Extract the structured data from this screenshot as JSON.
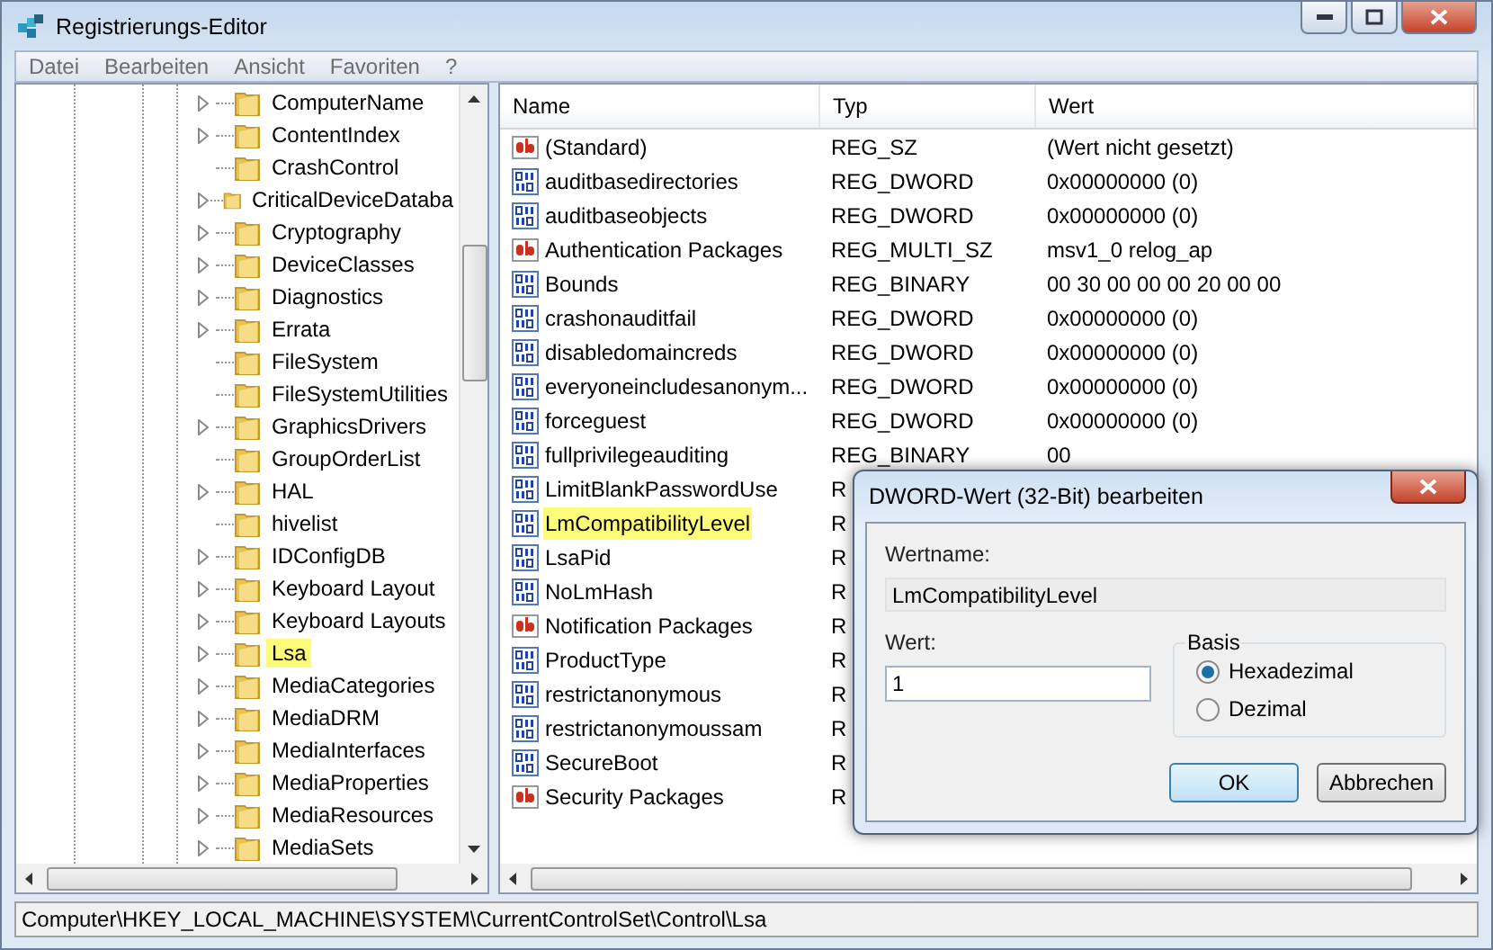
{
  "window": {
    "title": "Registrierungs-Editor"
  },
  "menu": [
    "Datei",
    "Bearbeiten",
    "Ansicht",
    "Favoriten",
    "?"
  ],
  "tree": {
    "items": [
      {
        "label": "ComputerName",
        "expandable": true,
        "selected": false
      },
      {
        "label": "ContentIndex",
        "expandable": true,
        "selected": false
      },
      {
        "label": "CrashControl",
        "expandable": false,
        "selected": false
      },
      {
        "label": "CriticalDeviceDataba",
        "expandable": true,
        "selected": false
      },
      {
        "label": "Cryptography",
        "expandable": true,
        "selected": false
      },
      {
        "label": "DeviceClasses",
        "expandable": true,
        "selected": false
      },
      {
        "label": "Diagnostics",
        "expandable": true,
        "selected": false
      },
      {
        "label": "Errata",
        "expandable": true,
        "selected": false
      },
      {
        "label": "FileSystem",
        "expandable": false,
        "selected": false
      },
      {
        "label": "FileSystemUtilities",
        "expandable": false,
        "selected": false
      },
      {
        "label": "GraphicsDrivers",
        "expandable": true,
        "selected": false
      },
      {
        "label": "GroupOrderList",
        "expandable": false,
        "selected": false
      },
      {
        "label": "HAL",
        "expandable": true,
        "selected": false
      },
      {
        "label": "hivelist",
        "expandable": false,
        "selected": false
      },
      {
        "label": "IDConfigDB",
        "expandable": true,
        "selected": false
      },
      {
        "label": "Keyboard Layout",
        "expandable": true,
        "selected": false
      },
      {
        "label": "Keyboard Layouts",
        "expandable": true,
        "selected": false
      },
      {
        "label": "Lsa",
        "expandable": true,
        "selected": true
      },
      {
        "label": "MediaCategories",
        "expandable": true,
        "selected": false
      },
      {
        "label": "MediaDRM",
        "expandable": true,
        "selected": false
      },
      {
        "label": "MediaInterfaces",
        "expandable": true,
        "selected": false
      },
      {
        "label": "MediaProperties",
        "expandable": true,
        "selected": false
      },
      {
        "label": "MediaResources",
        "expandable": true,
        "selected": false
      },
      {
        "label": "MediaSets",
        "expandable": true,
        "selected": false
      }
    ]
  },
  "table": {
    "columns": [
      "Name",
      "Typ",
      "Wert"
    ],
    "rows": [
      {
        "kind": "string",
        "name": "(Standard)",
        "type": "REG_SZ",
        "value": "(Wert nicht gesetzt)",
        "selected": false
      },
      {
        "kind": "binary",
        "name": "auditbasedirectories",
        "type": "REG_DWORD",
        "value": "0x00000000 (0)",
        "selected": false
      },
      {
        "kind": "binary",
        "name": "auditbaseobjects",
        "type": "REG_DWORD",
        "value": "0x00000000 (0)",
        "selected": false
      },
      {
        "kind": "string",
        "name": "Authentication Packages",
        "type": "REG_MULTI_SZ",
        "value": "msv1_0 relog_ap",
        "selected": false
      },
      {
        "kind": "binary",
        "name": "Bounds",
        "type": "REG_BINARY",
        "value": "00 30 00 00 00 20 00 00",
        "selected": false
      },
      {
        "kind": "binary",
        "name": "crashonauditfail",
        "type": "REG_DWORD",
        "value": "0x00000000 (0)",
        "selected": false
      },
      {
        "kind": "binary",
        "name": "disabledomaincreds",
        "type": "REG_DWORD",
        "value": "0x00000000 (0)",
        "selected": false
      },
      {
        "kind": "binary",
        "name": "everyoneincludesanonym...",
        "type": "REG_DWORD",
        "value": "0x00000000 (0)",
        "selected": false
      },
      {
        "kind": "binary",
        "name": "forceguest",
        "type": "REG_DWORD",
        "value": "0x00000000 (0)",
        "selected": false
      },
      {
        "kind": "binary",
        "name": "fullprivilegeauditing",
        "type": "REG_BINARY",
        "value": "00",
        "selected": false
      },
      {
        "kind": "binary",
        "name": "LimitBlankPasswordUse",
        "type": "R",
        "selected": false
      },
      {
        "kind": "binary",
        "name": "LmCompatibilityLevel",
        "type": "R",
        "selected": true
      },
      {
        "kind": "binary",
        "name": "LsaPid",
        "type": "R",
        "selected": false
      },
      {
        "kind": "binary",
        "name": "NoLmHash",
        "type": "R",
        "selected": false
      },
      {
        "kind": "string",
        "name": "Notification Packages",
        "type": "R",
        "selected": false
      },
      {
        "kind": "binary",
        "name": "ProductType",
        "type": "R",
        "selected": false
      },
      {
        "kind": "binary",
        "name": "restrictanonymous",
        "type": "R",
        "selected": false
      },
      {
        "kind": "binary",
        "name": "restrictanonymoussam",
        "type": "R",
        "selected": false
      },
      {
        "kind": "binary",
        "name": "SecureBoot",
        "type": "R",
        "selected": false
      },
      {
        "kind": "string",
        "name": "Security Packages",
        "type": "R",
        "selected": false
      }
    ]
  },
  "status_bar": "Computer\\HKEY_LOCAL_MACHINE\\SYSTEM\\CurrentControlSet\\Control\\Lsa",
  "dialog": {
    "title": "DWORD-Wert (32-Bit) bearbeiten",
    "name_label": "Wertname:",
    "name_value": "LmCompatibilityLevel",
    "value_label": "Wert:",
    "value": "1",
    "base_label": "Basis",
    "base_options": [
      {
        "label": "Hexadezimal",
        "selected": true
      },
      {
        "label": "Dezimal",
        "selected": false
      }
    ],
    "buttons": [
      {
        "label": "OK",
        "default": true
      },
      {
        "label": "Abbrechen",
        "default": false
      }
    ]
  }
}
